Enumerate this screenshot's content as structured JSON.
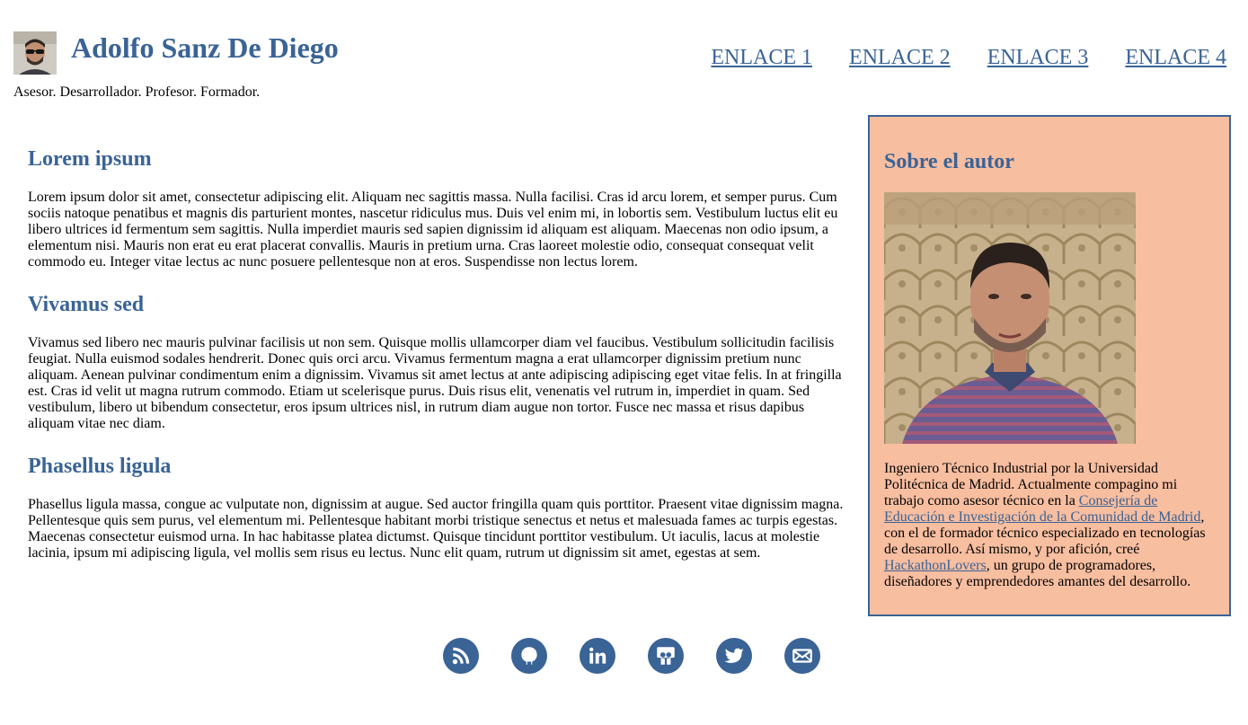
{
  "header": {
    "site_title": "Adolfo Sanz De Diego",
    "tagline": "Asesor. Desarrollador. Profesor. Formador."
  },
  "nav": {
    "links": [
      {
        "label": "ENLACE 1"
      },
      {
        "label": "ENLACE 2"
      },
      {
        "label": "ENLACE 3"
      },
      {
        "label": "ENLACE 4"
      }
    ]
  },
  "main": {
    "sections": [
      {
        "heading": "Lorem ipsum",
        "body": "Lorem ipsum dolor sit amet, consectetur adipiscing elit. Aliquam nec sagittis massa. Nulla facilisi. Cras id arcu lorem, et semper purus. Cum sociis natoque penatibus et magnis dis parturient montes, nascetur ridiculus mus. Duis vel enim mi, in lobortis sem. Vestibulum luctus elit eu libero ultrices id fermentum sem sagittis. Nulla imperdiet mauris sed sapien dignissim id aliquam est aliquam. Maecenas non odio ipsum, a elementum nisi. Mauris non erat eu erat placerat convallis. Mauris in pretium urna. Cras laoreet molestie odio, consequat consequat velit commodo eu. Integer vitae lectus ac nunc posuere pellentesque non at eros. Suspendisse non lectus lorem."
      },
      {
        "heading": "Vivamus sed",
        "body": "Vivamus sed libero nec mauris pulvinar facilisis ut non sem. Quisque mollis ullamcorper diam vel faucibus. Vestibulum sollicitudin facilisis feugiat. Nulla euismod sodales hendrerit. Donec quis orci arcu. Vivamus fermentum magna a erat ullamcorper dignissim pretium nunc aliquam. Aenean pulvinar condimentum enim a dignissim. Vivamus sit amet lectus at ante adipiscing adipiscing eget vitae felis. In at fringilla est. Cras id velit ut magna rutrum commodo. Etiam ut scelerisque purus. Duis risus elit, venenatis vel rutrum in, imperdiet in quam. Sed vestibulum, libero ut bibendum consectetur, eros ipsum ultrices nisl, in rutrum diam augue non tortor. Fusce nec massa et risus dapibus aliquam vitae nec diam."
      },
      {
        "heading": "Phasellus ligula",
        "body": "Phasellus ligula massa, congue ac vulputate non, dignissim at augue. Sed auctor fringilla quam quis porttitor. Praesent vitae dignissim magna. Pellentesque quis sem purus, vel elementum mi. Pellentesque habitant morbi tristique senectus et netus et malesuada fames ac turpis egestas. Maecenas consectetur euismod urna. In hac habitasse platea dictumst. Quisque tincidunt porttitor vestibulum. Ut iaculis, lacus at molestie lacinia, ipsum mi adipiscing ligula, vel mollis sem risus eu lectus. Nunc elit quam, rutrum ut dignissim sit amet, egestas at sem."
      }
    ]
  },
  "sidebar": {
    "heading": "Sobre el autor",
    "bio_part1": "Ingeniero Técnico Industrial por la Universidad Politécnica de Madrid. Actualmente compagino mi trabajo como asesor técnico en la ",
    "link1": "Consejería de Educación e Investigación de la Comunidad de Madrid",
    "bio_part2": ", con el de formador técnico especializado en tecnologías de desarrollo. Así mismo, y por afición, creé ",
    "link2": "HackathonLovers",
    "bio_part3": ", un grupo de programadores, diseñadores y emprendedores amantes del desarrollo."
  },
  "social": {
    "icons": [
      "rss-icon",
      "github-icon",
      "linkedin-icon",
      "slideshare-icon",
      "twitter-icon",
      "email-icon"
    ]
  },
  "colors": {
    "accent": "#3a6396",
    "sidebar_bg": "#f8bea0"
  }
}
